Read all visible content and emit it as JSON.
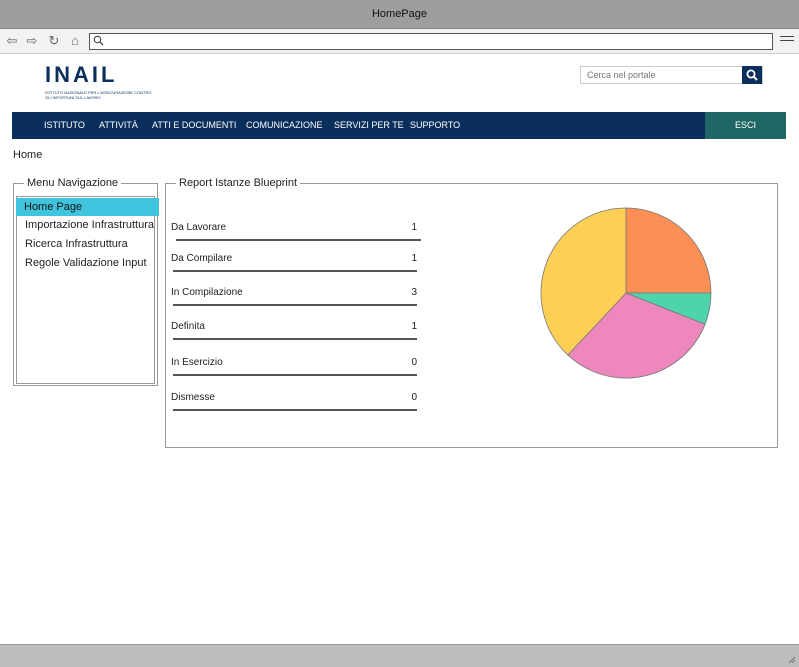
{
  "window": {
    "title": "HomePage"
  },
  "browser": {
    "url_value": ""
  },
  "header": {
    "logo_text": "INAIL",
    "logo_subtitle": "ISTITUTO NAZIONALE PER L'ASSICURAZIONE CONTRO GLI INFORTUNI SUL LAVORO",
    "search_placeholder": "Cerca nel portale"
  },
  "nav": {
    "items": [
      "ISTITUTO",
      "ATTIVITÀ",
      "ATTI E DOCUMENTI",
      "COMUNICAZIONE",
      "SERVIZI PER TE",
      "SUPPORTO"
    ],
    "logout_label": "ESCI"
  },
  "breadcrumb": "Home",
  "sidebar": {
    "title": "Menu Navigazione",
    "items": [
      {
        "label": "Home Page",
        "active": true
      },
      {
        "label": "Importazione Infrastruttura",
        "active": false
      },
      {
        "label": "Ricerca Infrastruttura",
        "active": false
      },
      {
        "label": "Regole Validazione Input",
        "active": false
      }
    ]
  },
  "report": {
    "title": "Report Istanze Blueprint",
    "rows": [
      {
        "label": "Da Lavorare",
        "value": "1"
      },
      {
        "label": "Da Compilare",
        "value": "1"
      },
      {
        "label": "In Compilazione",
        "value": "3"
      },
      {
        "label": "Definita",
        "value": "1"
      },
      {
        "label": "In Esercizio",
        "value": "0"
      },
      {
        "label": "Dismesse",
        "value": "0"
      }
    ]
  },
  "chart_data": {
    "type": "pie",
    "slices": [
      {
        "value": 25,
        "color": "#fb8f55"
      },
      {
        "value": 6,
        "color": "#4dd4ad"
      },
      {
        "value": 31,
        "color": "#ee88bc"
      },
      {
        "value": 38,
        "color": "#fecf55"
      }
    ]
  },
  "colors": {
    "nav_bg": "#0b2f5c",
    "logout_bg": "#1f6665",
    "active_menu": "#40c4dd"
  }
}
